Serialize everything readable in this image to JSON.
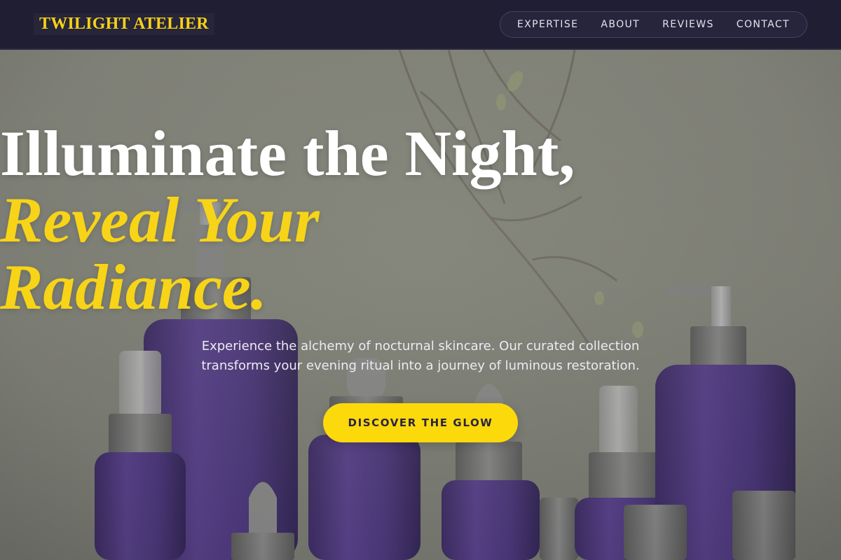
{
  "header": {
    "brand": "TWILIGHT ATELIER",
    "nav": [
      {
        "label": "EXPERTISE"
      },
      {
        "label": "ABOUT"
      },
      {
        "label": "REVIEWS"
      },
      {
        "label": "CONTACT"
      }
    ]
  },
  "hero": {
    "headline_line1": "Illuminate the Night,",
    "headline_line2": "Reveal Your",
    "headline_line3": "Radiance.",
    "subcopy": "Experience the alchemy of nocturnal skincare. Our curated collection transforms your evening ritual into a journey of luminous restoration.",
    "cta_label": "DISCOVER THE GLOW",
    "background_image": "purple-glass-skincare-bottles-photo"
  },
  "colors": {
    "header_bg": "#1f1e33",
    "accent_yellow": "#f7d417",
    "bottle_purple": "#4a3378",
    "cap_gray": "#7a7a7a"
  }
}
